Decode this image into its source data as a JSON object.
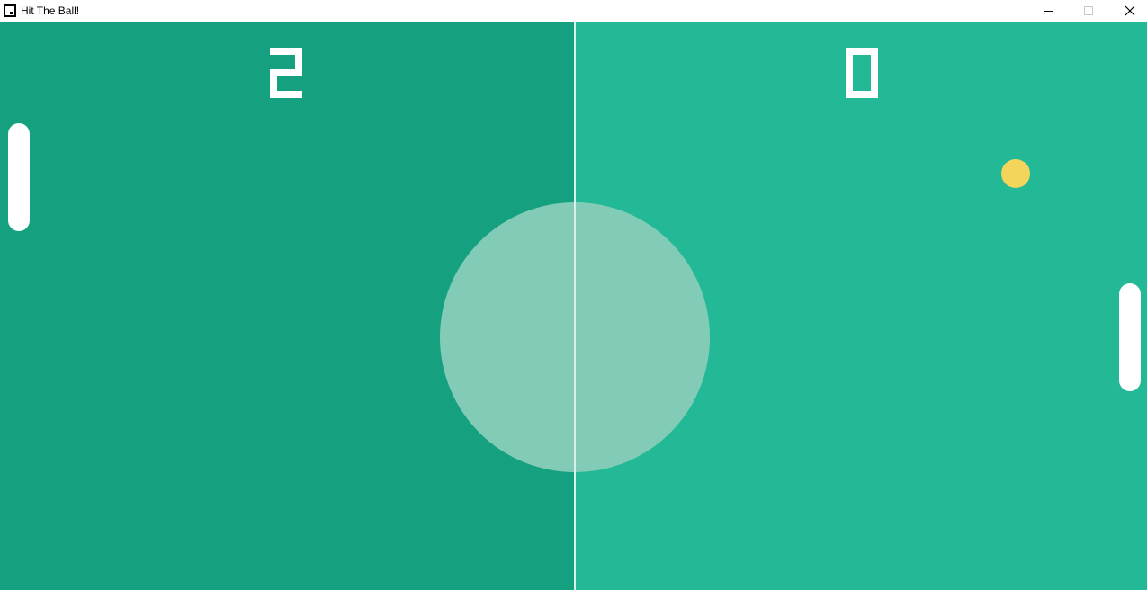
{
  "window": {
    "title": "Hit The Ball!",
    "icons": {
      "app": "app-window-icon",
      "minimize": "minimize-icon",
      "maximize": "maximize-icon",
      "close": "close-icon"
    }
  },
  "game": {
    "scores": {
      "left": "2",
      "right": "0"
    },
    "colors": {
      "left_half": "#15a080",
      "right_half": "#24b996",
      "center_circle": "#82ccb7",
      "center_line": "#d7f1ea",
      "paddle": "#ffffff",
      "ball": "#f3d55b",
      "score": "#ffffff"
    }
  }
}
